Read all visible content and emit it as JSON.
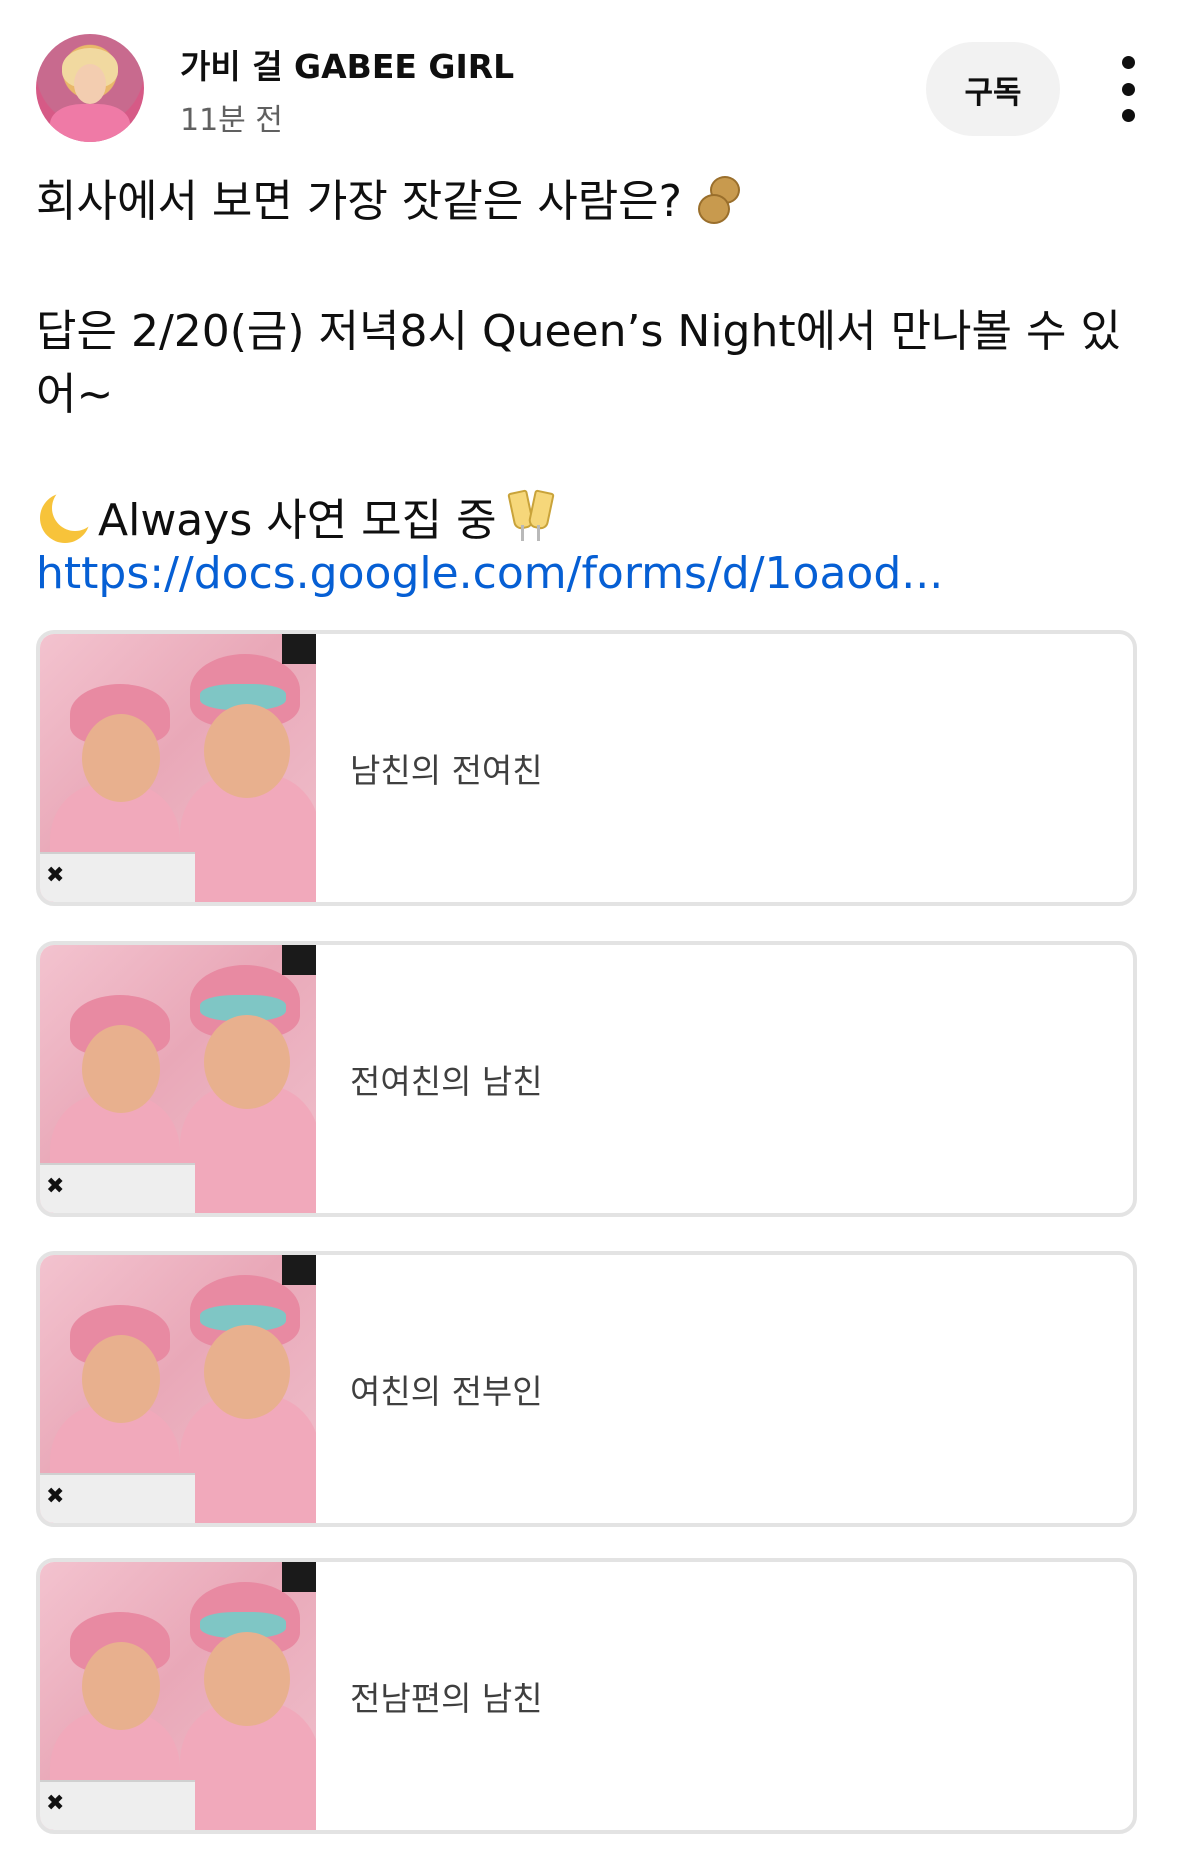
{
  "header": {
    "channel_name": "가비 걸 GABEE GIRL",
    "timestamp": "11분 전",
    "subscribe_label": "구독"
  },
  "post": {
    "question": "회사에서 보면 가장 잣같은 사람은?",
    "answer_line1": "답은 2/20(금) 저녁8시 Queen’s Night에서 만나볼 수 있",
    "answer_line2": "어~",
    "recruit": "Always 사연 모집 중",
    "link": "https://docs.google.com/forms/d/1oaod..."
  },
  "icons": {
    "question_emoji": "peanut-icon",
    "recruit_prefix_emoji": "crescent-moon-icon",
    "recruit_suffix_emoji": "champagne-glasses-icon"
  },
  "poll": {
    "options": [
      {
        "label": "남친의 전여친"
      },
      {
        "label": "전여친의 남친"
      },
      {
        "label": "여친의 전부인"
      },
      {
        "label": "전남편의 남친"
      }
    ]
  },
  "colors": {
    "link": "#065fd4",
    "subscribe_bg": "#f2f2f2",
    "option_border": "#e3e3e3"
  }
}
